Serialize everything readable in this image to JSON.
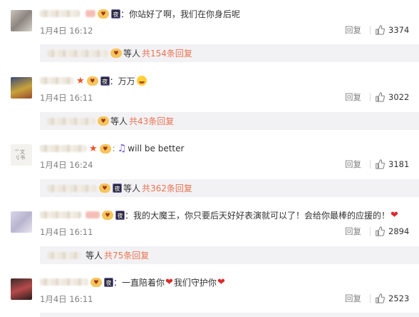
{
  "comments": [
    {
      "text": "：你站好了啊，我们在你身后呢",
      "time": "1月4日 16:12",
      "reply_label": "回复",
      "likes": "3374",
      "sub": {
        "people": "等人",
        "total": "共154条回复"
      }
    },
    {
      "text": "：万万",
      "time": "1月4日 16:11",
      "reply_label": "回复",
      "likes": "3022",
      "sub": {
        "people": "等人",
        "total": "共43条回复"
      }
    },
    {
      "text": "will be better",
      "time": "1月4日 16:24",
      "reply_label": "回复",
      "likes": "3181",
      "sub": {
        "people": "等人",
        "total": "共362条回复"
      }
    },
    {
      "text": "：我的大魔王，你只要后天好好表演就可以了！会给你最棒的应援的！",
      "time": "1月4日 16:11",
      "reply_label": "回复",
      "likes": "2894",
      "sub": {
        "people": "等人",
        "total": "共75条回复"
      }
    },
    {
      "text_a": "：一直陪着你",
      "text_b": "我们守护你",
      "time": "1月4日 16:11",
      "reply_label": "回复",
      "likes": "2523"
    }
  ],
  "badges": {
    "night": "夜",
    "vip": "V"
  },
  "colors": {
    "link_orange": "#eb7350",
    "heart": "#e02828",
    "sub_bg": "#f2f2f5",
    "meta_gray": "#808080"
  },
  "icons": [
    "thumbs-up-icon",
    "music-note-icon",
    "heart-icon",
    "crying-emoji-icon",
    "red-star-icon",
    "night-badge-icon",
    "vip-badge-icon"
  ]
}
